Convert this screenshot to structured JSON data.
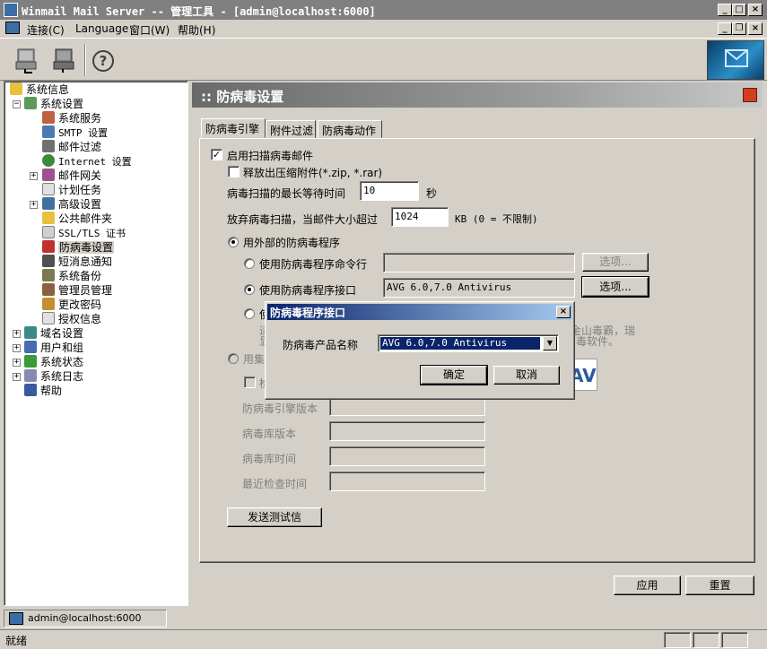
{
  "window": {
    "title": "Winmail Mail Server -- 管理工具 - [admin@localhost:6000]"
  },
  "menu": {
    "connect": "连接(C)",
    "language": "Language",
    "window": "窗口(W)",
    "help": "帮助(H)"
  },
  "tree": {
    "items": [
      {
        "label": "系统信息"
      },
      {
        "label": "系统设置"
      },
      {
        "label": "系统服务"
      },
      {
        "label": "SMTP 设置"
      },
      {
        "label": "邮件过滤"
      },
      {
        "label": "Internet 设置"
      },
      {
        "label": "邮件网关"
      },
      {
        "label": "计划任务"
      },
      {
        "label": "高级设置"
      },
      {
        "label": "公共邮件夹"
      },
      {
        "label": "SSL/TLS 证书"
      },
      {
        "label": "防病毒设置"
      },
      {
        "label": "短消息通知"
      },
      {
        "label": "系统备份"
      },
      {
        "label": "管理员管理"
      },
      {
        "label": "更改密码"
      },
      {
        "label": "授权信息"
      },
      {
        "label": "域名设置"
      },
      {
        "label": "用户和组"
      },
      {
        "label": "系统状态"
      },
      {
        "label": "系统日志"
      },
      {
        "label": "帮助"
      }
    ]
  },
  "panel": {
    "title": ":: 防病毒设置"
  },
  "tabs": [
    "防病毒引擎",
    "附件过滤",
    "防病毒动作"
  ],
  "engine": {
    "enable_scan": "启用扫描病毒邮件",
    "release_archive": "释放出压缩附件(*.zip, *.rar)",
    "max_wait_label": "病毒扫描的最长等待时间",
    "max_wait_value": "10",
    "max_wait_unit": "秒",
    "skip_size_label": "放弃病毒扫描，当邮件大小超过",
    "skip_size_value": "1024",
    "skip_size_unit": "KB  (0 = 不限制)",
    "external_label": "用外部的防病毒程序",
    "cmdline_label": "使用防病毒程序命令行",
    "cmdline_value": "",
    "options_disabled": "选项...",
    "interface_label": "使用防病毒程序接口",
    "interface_value": "AVG 6.0,7.0 Antivirus",
    "options_enabled": "选项...",
    "third_radio_partial": "使",
    "behind_text_1": "金山毒霸，瑞",
    "behind_text_2": "毒软件。",
    "behind_left_1": "适",
    "behind_left_2": "显",
    "builtin_label": "用集",
    "builtin_check_partial": "检",
    "av_logo": "AV",
    "engine_version_label": "防病毒引擎版本",
    "db_version_label": "病毒库版本",
    "db_time_label": "病毒库时间",
    "last_check_label": "最近检查时间",
    "send_test": "发送测试信"
  },
  "footer": {
    "apply": "应用",
    "reset": "重置"
  },
  "dialog": {
    "title": "防病毒程序接口",
    "product_label": "防病毒产品名称",
    "product_value": "AVG 6.0,7.0 Antivirus",
    "ok": "确定",
    "cancel": "取消"
  },
  "statusbar": {
    "connection": "admin@localhost:6000",
    "status": "就绪"
  }
}
